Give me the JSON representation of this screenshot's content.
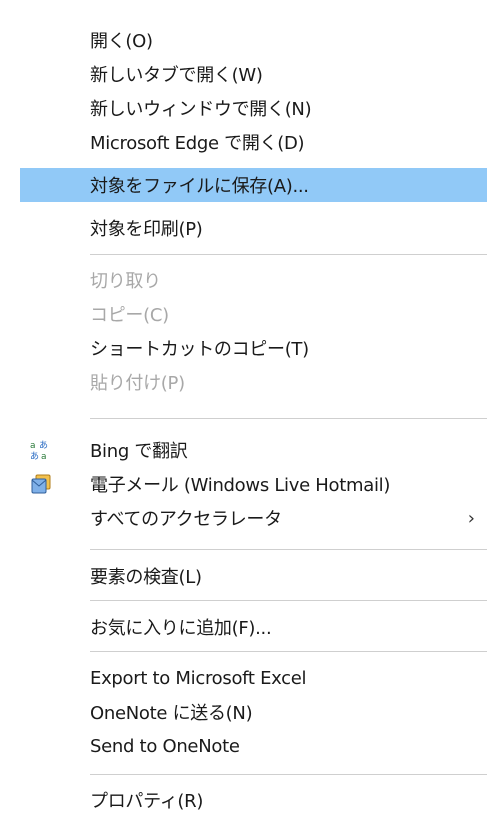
{
  "context_menu": {
    "items": [
      {
        "label": "開く(O)"
      },
      {
        "label": "新しいタブで開く(W)"
      },
      {
        "label": "新しいウィンドウで開く(N)"
      },
      {
        "label": "Microsoft Edge で開く(D)"
      },
      {
        "label": "対象をファイルに保存(A)..."
      },
      {
        "label": "対象を印刷(P)"
      },
      {
        "label": "切り取り"
      },
      {
        "label": "コピー(C)"
      },
      {
        "label": "ショートカットのコピー(T)"
      },
      {
        "label": "貼り付け(P)"
      },
      {
        "label": "Bing で翻訳"
      },
      {
        "label": "電子メール (Windows Live Hotmail)"
      },
      {
        "label": "すべてのアクセラレータ"
      },
      {
        "label": "要素の検査(L)"
      },
      {
        "label": "お気に入りに追加(F)..."
      },
      {
        "label": "Export to Microsoft Excel"
      },
      {
        "label": "OneNote に送る(N)"
      },
      {
        "label": "Send to OneNote"
      },
      {
        "label": "プロパティ(R)"
      }
    ],
    "highlighted_item": "対象をファイルに保存(A)...",
    "disabled_items": [
      "切り取り",
      "コピー(C)",
      "貼り付け(P)"
    ],
    "submenu_indicator": "›",
    "icons": {
      "translate": "bing-translate-icon",
      "email": "email-hotmail-icon"
    },
    "colors": {
      "highlight": "#91c9f7",
      "text": "#1a1a1a",
      "disabled_text": "#a8a8a8",
      "separator": "#cfcfcf"
    }
  }
}
